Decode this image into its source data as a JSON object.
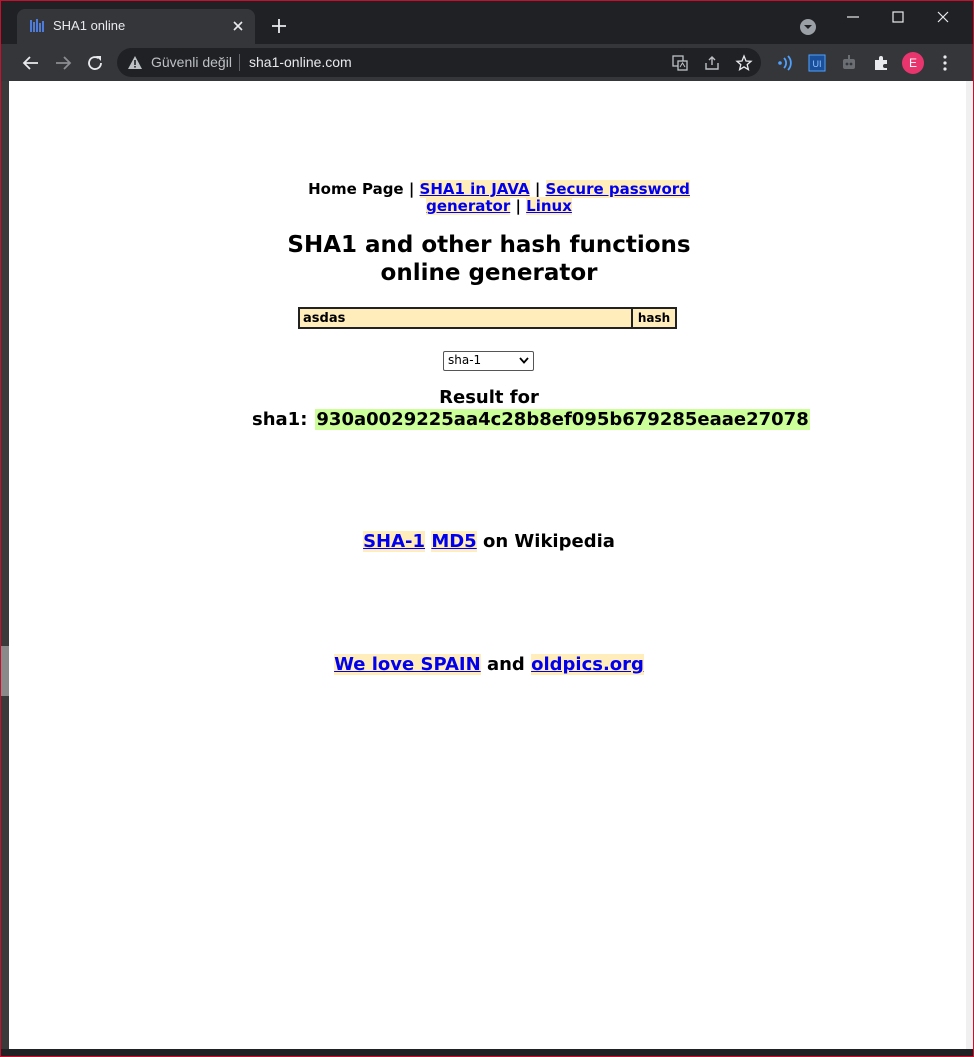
{
  "browser": {
    "tab": {
      "title": "SHA1 online"
    },
    "omnibox": {
      "security_label": "Güvenli değil",
      "url": "sha1-online.com"
    },
    "profile_initial": "E"
  },
  "page": {
    "nav": {
      "home": "Home Page",
      "sep1": " | ",
      "sha1_java": "SHA1 in JAVA",
      "sep2": " | ",
      "password_gen": "Secure password generator",
      "sep3": " | ",
      "linux": "Linux"
    },
    "title_line1": "SHA1 and other hash functions",
    "title_line2": "online generator",
    "form": {
      "input_value": "asdas",
      "button_label": "hash",
      "algorithm": "sha-1"
    },
    "result": {
      "heading": "Result for",
      "label": "sha1:",
      "hash": "930a0029225aa4c28b8ef095b679285eaae27078"
    },
    "wiki": {
      "link1": "SHA-1",
      "link2": "MD5",
      "suffix": " on Wikipedia"
    },
    "footer": {
      "link1": "We love SPAIN",
      "middle": " and ",
      "link2": "oldpics.org"
    }
  },
  "colors": {
    "link": "#0000ee",
    "link_bg": "#ffeebb",
    "hash_bg": "#ccff99",
    "chrome_dark": "#202124",
    "chrome_toolbar": "#35363a"
  }
}
